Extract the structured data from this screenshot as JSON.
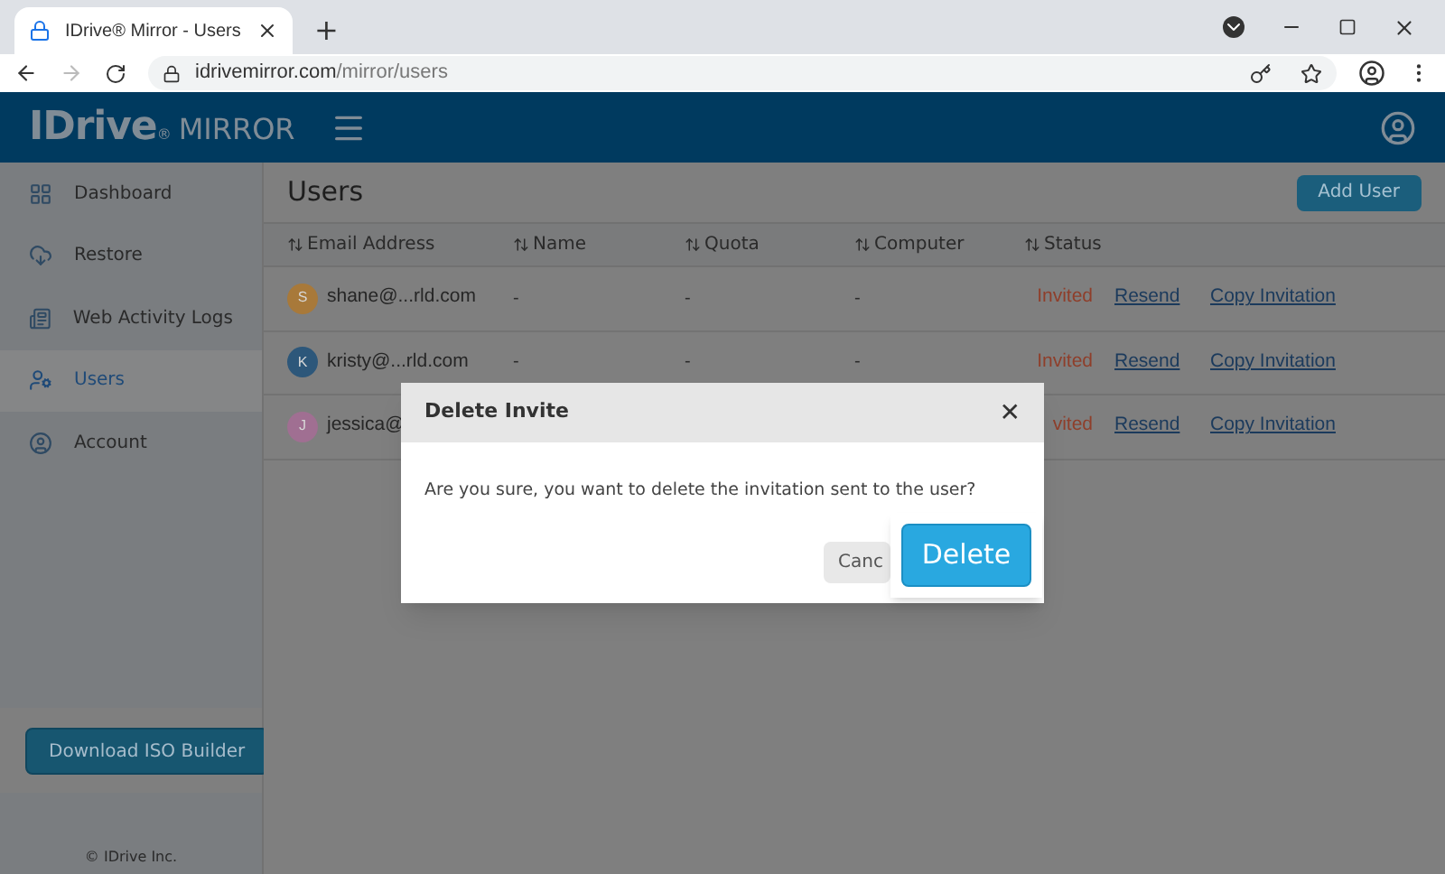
{
  "browser": {
    "tab_title": "IDrive® Mirror - Users",
    "new_tab": "+",
    "url_host": "idrivemirror.com",
    "url_path": "/mirror/users"
  },
  "header": {
    "logo_main": "IDrive",
    "logo_reg": "®",
    "logo_sub": "MIRROR"
  },
  "sidebar": {
    "items": [
      {
        "label": "Dashboard",
        "selected": false
      },
      {
        "label": "Restore",
        "selected": false
      },
      {
        "label": "Web Activity Logs",
        "selected": false
      },
      {
        "label": "Users",
        "selected": true
      },
      {
        "label": "Account",
        "selected": false
      }
    ],
    "download_button": "Download ISO Builder",
    "footer": "© IDrive Inc."
  },
  "page": {
    "title": "Users",
    "add_button": "Add User"
  },
  "table": {
    "columns": [
      "Email Address",
      "Name",
      "Quota",
      "Computer",
      "Status"
    ],
    "rows": [
      {
        "initial": "S",
        "color": "#a8793a",
        "email": "shane@...rld.com",
        "name": "-",
        "quota": "-",
        "computer": "-",
        "status": "Invited",
        "resend": "Resend",
        "copy": "Copy Invitation"
      },
      {
        "initial": "K",
        "color": "#2d577a",
        "email": "kristy@...rld.com",
        "name": "-",
        "quota": "-",
        "computer": "-",
        "status": "Invited",
        "resend": "Resend",
        "copy": "Copy Invitation"
      },
      {
        "initial": "J",
        "color": "#a06f92",
        "email": "jessica@",
        "status": "vited",
        "resend": "Resend",
        "copy": "Copy Invitation"
      }
    ]
  },
  "dialog": {
    "title": "Delete Invite",
    "close": "✕",
    "message": "Are you sure, you want to delete the invitation sent to the user?",
    "cancel": "Canc",
    "confirm": "Delete"
  }
}
